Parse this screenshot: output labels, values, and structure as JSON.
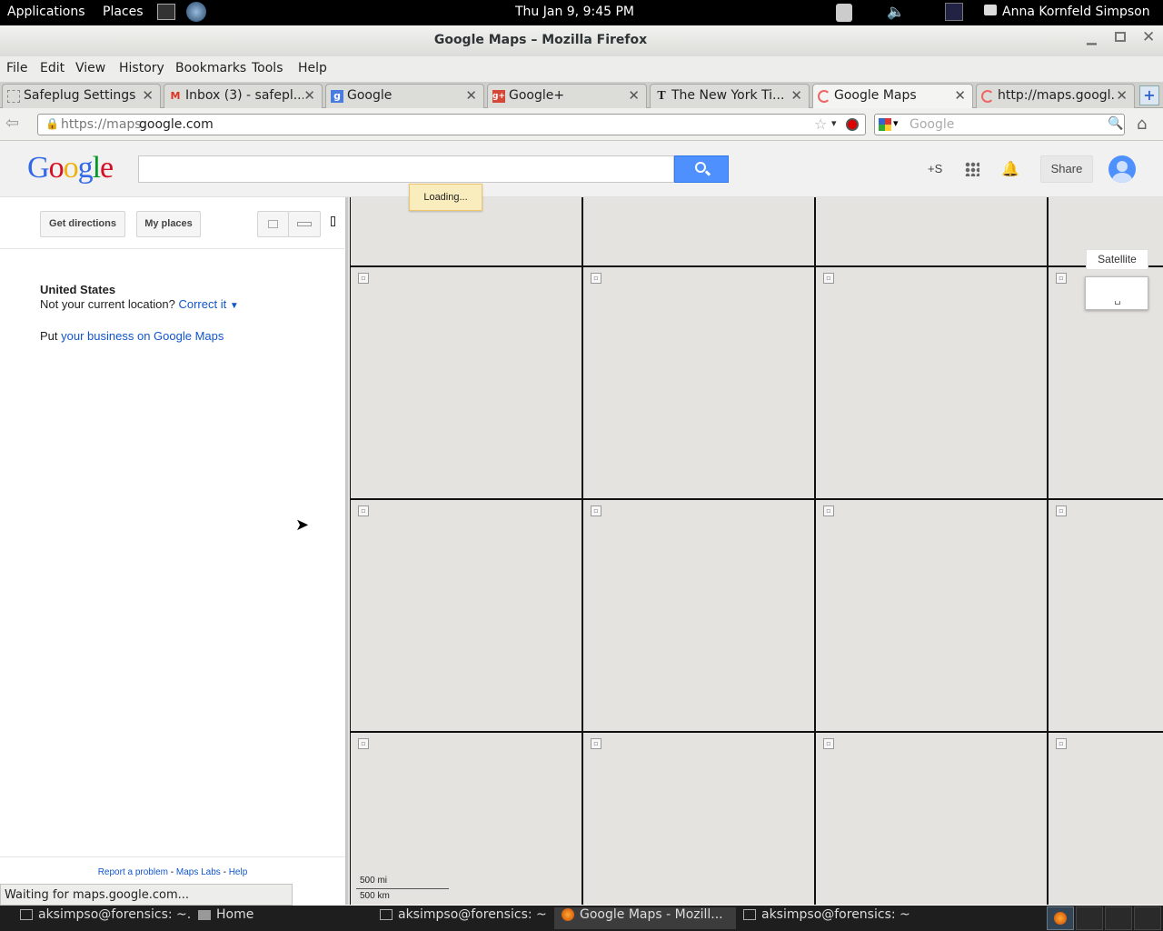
{
  "topbar": {
    "applications": "Applications",
    "places": "Places",
    "clock": "Thu Jan  9,  9:45 PM",
    "user": "Anna Kornfeld Simpson"
  },
  "window": {
    "title": "Google Maps – Mozilla Firefox"
  },
  "menu": [
    "File",
    "Edit",
    "View",
    "History",
    "Bookmarks",
    "Tools",
    "Help"
  ],
  "tabs": [
    {
      "label": "Safeplug Settings",
      "icon": "page-icon"
    },
    {
      "label": "Inbox (3) - safepl...",
      "icon": "gmail-icon"
    },
    {
      "label": "Google",
      "icon": "google-icon"
    },
    {
      "label": "Google+",
      "icon": "google-plus-icon"
    },
    {
      "label": "The New York Ti...",
      "icon": "nyt-icon"
    },
    {
      "label": "Google Maps",
      "icon": "loading-icon"
    },
    {
      "label": "http://maps.googl...",
      "icon": "loading-icon"
    }
  ],
  "navbar": {
    "url_prefix": "https://maps.",
    "url_domain": "google.com",
    "search_placeholder": "Google"
  },
  "gmaps": {
    "logo": [
      "G",
      "o",
      "o",
      "g",
      "l",
      "e"
    ],
    "logo_colors": [
      "#3369e8",
      "#d50f25",
      "#eeb211",
      "#3369e8",
      "#009925",
      "#d50f25"
    ],
    "plus_s": "+S",
    "share": "Share",
    "loading": "Loading...",
    "get_directions": "Get directions",
    "my_places": "My places",
    "location_title": "United States",
    "not_location": "Not your current location?",
    "correct_it": "Correct it",
    "put": "Put",
    "business_link": "your business on Google Maps",
    "satellite": "Satellite",
    "scale_mi": "500 mi",
    "scale_km": "500 km",
    "footer_report": "Report a problem",
    "footer_sep": "-",
    "footer_labs": "Maps Labs",
    "footer_help": "Help"
  },
  "statusbar": {
    "text": "Waiting for maps.google.com..."
  },
  "taskbar": [
    {
      "label": "aksimpso@forensics: ~...",
      "icon": "terminal-icon"
    },
    {
      "label": "Home",
      "icon": "folder-icon"
    },
    {
      "label": "aksimpso@forensics: ~",
      "icon": "terminal-icon"
    },
    {
      "label": "Google Maps - Mozill...",
      "icon": "firefox-icon"
    },
    {
      "label": "aksimpso@forensics: ~",
      "icon": "terminal-icon"
    }
  ]
}
